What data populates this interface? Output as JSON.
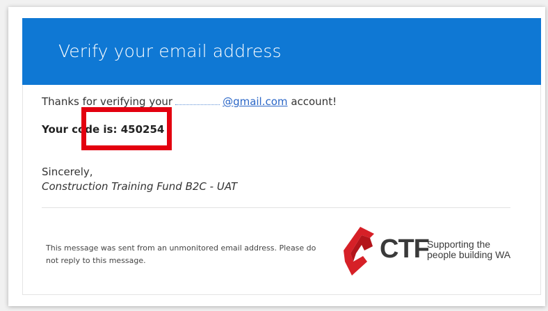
{
  "email": {
    "header_title": "Verify your email address",
    "greeting_prefix": "Thanks for verifying your",
    "email_domain": "@gmail.com",
    "greeting_suffix": "account!",
    "code_label": "Your code is:",
    "code_value": "450254",
    "sign_off": "Sincerely,",
    "sender_name": "Construction Training Fund B2C - UAT",
    "footer_note": "This message was sent from an unmonitored email address. Please do not reply to this message."
  },
  "logo": {
    "name": "CTF",
    "tagline_line1": "Supporting the",
    "tagline_line2": "people building WA"
  },
  "colors": {
    "header_blue": "#0f78d4",
    "highlight_red": "#e3000f",
    "logo_red": "#d62027",
    "link_blue": "#2a66c7"
  }
}
